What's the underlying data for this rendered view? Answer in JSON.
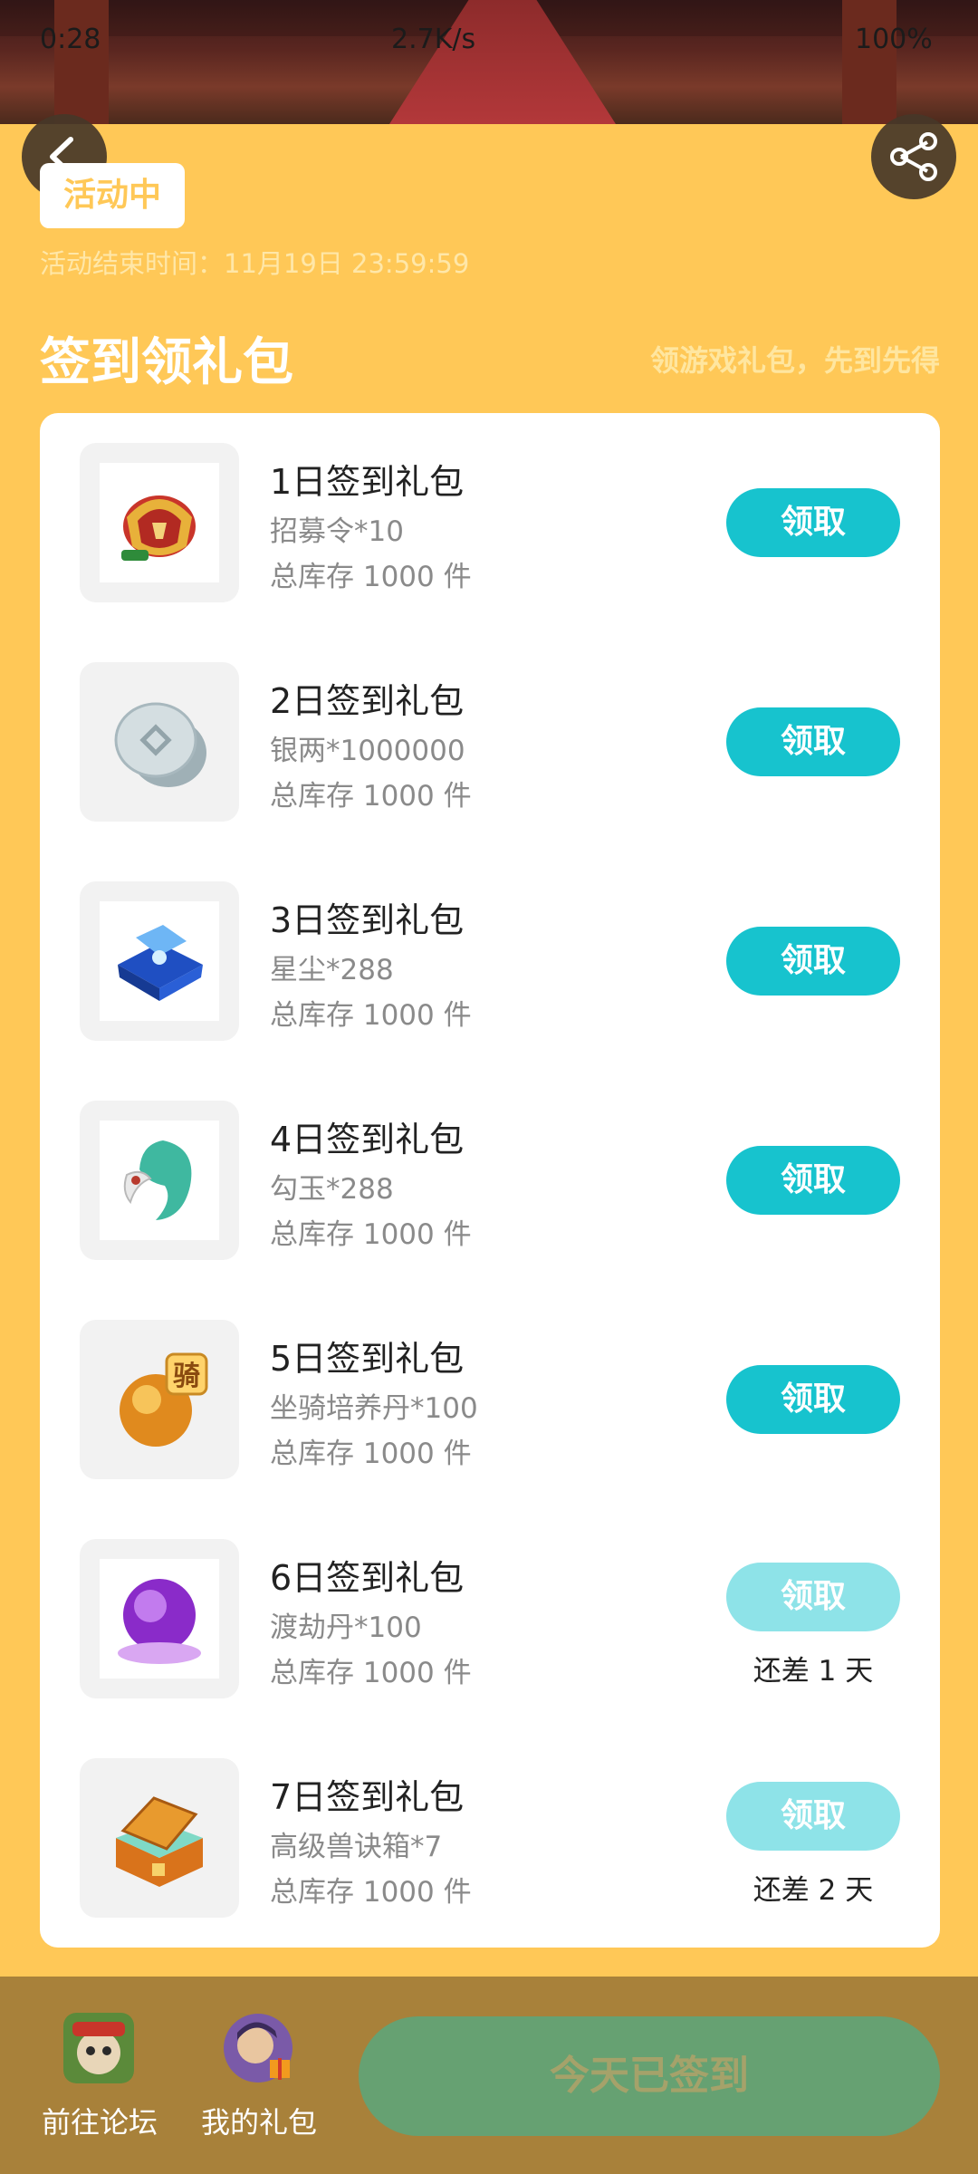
{
  "status_bar": {
    "time": "0:28",
    "net_speed": "2.7K/s",
    "battery": "100%"
  },
  "header": {
    "tag": "活动中",
    "end_time": "活动结束时间：11月19日 23:59:59"
  },
  "section": {
    "title": "签到领礼包",
    "subtitle": "领游戏礼包，先到先得"
  },
  "gifts": [
    {
      "name": "1日签到礼包",
      "item": "招募令*10",
      "stock": "总库存 1000 件",
      "button": "领取",
      "state": "active",
      "remain": "",
      "icon": "recruit-token-icon"
    },
    {
      "name": "2日签到礼包",
      "item": "银两*1000000",
      "stock": "总库存 1000 件",
      "button": "领取",
      "state": "active",
      "remain": "",
      "icon": "silver-coin-icon"
    },
    {
      "name": "3日签到礼包",
      "item": "星尘*288",
      "stock": "总库存 1000 件",
      "button": "领取",
      "state": "active",
      "remain": "",
      "icon": "stardust-chest-icon"
    },
    {
      "name": "4日签到礼包",
      "item": "勾玉*288",
      "stock": "总库存 1000 件",
      "button": "领取",
      "state": "active",
      "remain": "",
      "icon": "magatama-icon"
    },
    {
      "name": "5日签到礼包",
      "item": "坐骑培养丹*100",
      "stock": "总库存 1000 件",
      "button": "领取",
      "state": "active",
      "remain": "",
      "icon": "mount-pill-icon"
    },
    {
      "name": "6日签到礼包",
      "item": "渡劫丹*100",
      "stock": "总库存 1000 件",
      "button": "领取",
      "state": "disabled",
      "remain": "还差 1 天",
      "icon": "purple-orb-icon"
    },
    {
      "name": "7日签到礼包",
      "item": "高级兽诀箱*7",
      "stock": "总库存 1000 件",
      "button": "领取",
      "state": "disabled",
      "remain": "还差 2 天",
      "icon": "treasure-chest-icon"
    }
  ],
  "bottom_bar": {
    "forum": "前往论坛",
    "my_gifts": "我的礼包",
    "signed": "今天已签到"
  },
  "colors": {
    "background": "#FFC857",
    "button_active": "#17C3CE",
    "button_disabled": "#8EE3E8",
    "signed_button": "#66A172",
    "bottom_bar": "#A8813A"
  }
}
